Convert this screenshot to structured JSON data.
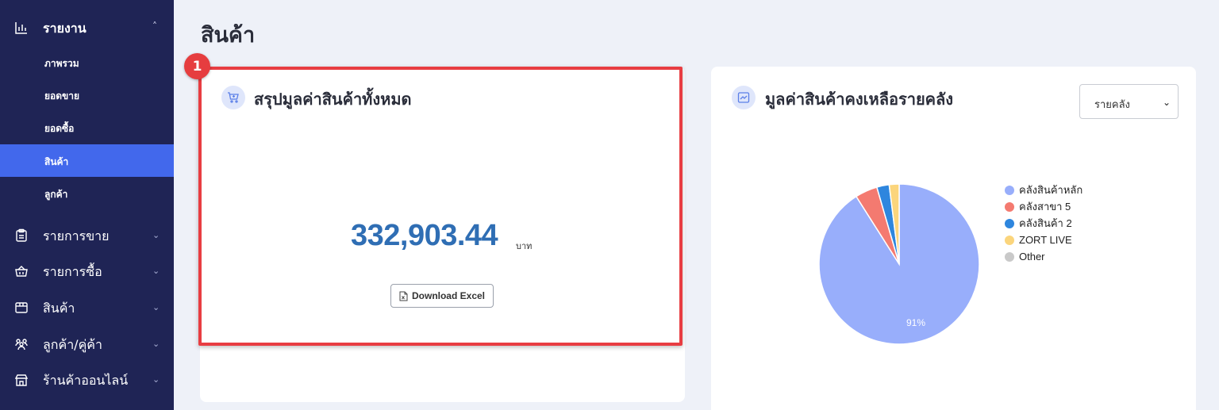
{
  "sidebar": {
    "header": {
      "label": "รายงาน",
      "icon": "bar-chart-icon"
    },
    "sub_items": [
      {
        "label": "ภาพรวม",
        "active": false
      },
      {
        "label": "ยอดขาย",
        "active": false
      },
      {
        "label": "ยอดซื้อ",
        "active": false
      },
      {
        "label": "สินค้า",
        "active": true
      },
      {
        "label": "ลูกค้า",
        "active": false
      }
    ],
    "nav_items": [
      {
        "label": "รายการขาย",
        "icon": "clipboard-icon"
      },
      {
        "label": "รายการซื้อ",
        "icon": "basket-icon"
      },
      {
        "label": "สินค้า",
        "icon": "box-icon"
      },
      {
        "label": "ลูกค้า/คู่ค้า",
        "icon": "users-icon"
      },
      {
        "label": "ร้านค้าออนไลน์",
        "icon": "store-icon"
      }
    ]
  },
  "page": {
    "title": "สินค้า"
  },
  "annotation": {
    "badge": "1"
  },
  "summary_card": {
    "title": "สรุปมูลค่าสินค้าทั้งหมด",
    "amount": "332,903.44",
    "unit": "บาท",
    "download_label": "Download Excel"
  },
  "warehouse_card": {
    "title": "มูลค่าสินค้าคงเหลือรายคลัง",
    "select_value": "รายคลัง",
    "pie_label": "91%"
  },
  "colors": {
    "sidebar_bg": "#1f2455",
    "active_item": "#4268ec",
    "accent_number": "#2f6eb4",
    "highlight_border": "#e83d42"
  },
  "chart_data": {
    "type": "pie",
    "series": [
      {
        "name": "คลังสินค้าหลัก",
        "value": 91,
        "color": "#98aefb"
      },
      {
        "name": "คลังสาขา 5",
        "value": 4.5,
        "color": "#f47a70"
      },
      {
        "name": "คลังสินค้า 2",
        "value": 2.5,
        "color": "#2e86de"
      },
      {
        "name": "ZORT LIVE",
        "value": 2,
        "color": "#fbd57c"
      },
      {
        "name": "Other",
        "value": 0,
        "color": "#c9c9c9"
      }
    ],
    "legend_placement": "right"
  }
}
